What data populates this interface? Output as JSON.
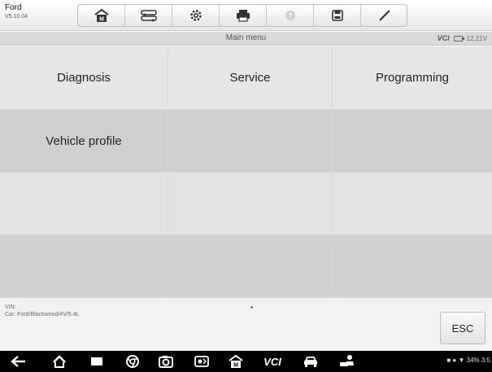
{
  "app": {
    "brand": "Ford",
    "version": "V5.10.04"
  },
  "toolbar": {
    "icons": [
      "home-icon",
      "vehicle-swap-icon",
      "settings-gear-icon",
      "print-icon",
      "help-icon",
      "save-icon",
      "edit-pen-icon"
    ]
  },
  "subheader": {
    "title": "Main menu",
    "vci_label": "VCI",
    "voltage": "12.21V"
  },
  "menu": {
    "items": [
      "Diagnosis",
      "Service",
      "Programming",
      "Vehicle profile"
    ]
  },
  "footer": {
    "vin_label": "VIN:",
    "car_info": "Car: Ford/Blackwood/4V/5.4L",
    "esc_label": "ESC"
  },
  "navbar": {
    "icons": [
      "back-icon",
      "home-icon",
      "recent-apps-icon",
      "chrome-icon",
      "camera-icon",
      "screen-settings-icon",
      "autel-home-icon",
      "vci-icon",
      "car-icon",
      "mechanic-icon"
    ],
    "vcl_label": "VCI",
    "status": "34% 3:5"
  }
}
